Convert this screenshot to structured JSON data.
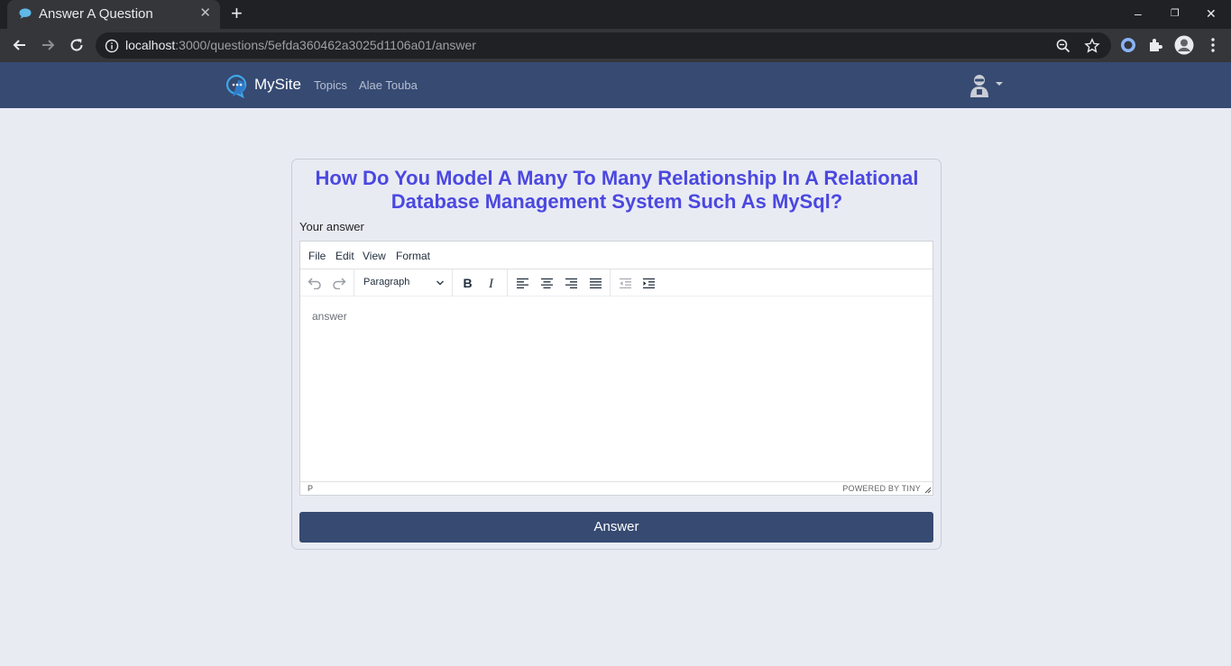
{
  "browser": {
    "tab_title": "Answer A Question",
    "tab_close": "✕",
    "new_tab": "+",
    "url_host": "localhost",
    "url_path": ":3000/questions/5efda360462a3025d1106a01/answer",
    "window_controls": {
      "minimize": "–",
      "restore": "❐",
      "close": "✕"
    }
  },
  "navbar": {
    "brand": "MySite",
    "links": [
      "Topics",
      "Alae Touba"
    ],
    "user_menu_icon": "user-avatar-icon"
  },
  "main": {
    "question_title": "How Do You Model A Many To Many Relationship In A Relational Database Management System Such As MySql?",
    "answer_label": "Your answer",
    "editor": {
      "menu": [
        "File",
        "Edit",
        "View",
        "Format"
      ],
      "block_format": "Paragraph",
      "placeholder": "answer",
      "status_path": "P",
      "branding": "POWERED BY TINY"
    },
    "submit_label": "Answer"
  },
  "colors": {
    "navbar": "#364a72",
    "title": "#4b48e0",
    "background": "#e9ebf3",
    "button": "#364a72"
  }
}
